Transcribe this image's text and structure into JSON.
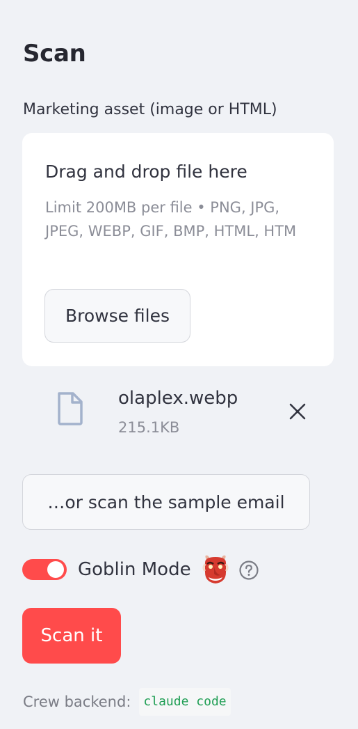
{
  "sidebar": {
    "title": "Scan",
    "uploader": {
      "label": "Marketing asset (image or HTML)",
      "dropzone_title": "Drag and drop file here",
      "limit_text": "Limit 200MB per file • PNG, JPG, JPEG, WEBP, GIF, BMP, HTML, HTM",
      "browse_label": "Browse files"
    },
    "uploaded_file": {
      "name": "olaplex.webp",
      "size": "215.1KB",
      "icon": "file-icon",
      "remove_icon": "close-icon"
    },
    "sample_button_label": "…or scan the sample email",
    "goblin_toggle": {
      "label": "Goblin Mode",
      "enabled": true,
      "emoji_icon": "goblin-mask-icon",
      "help_icon": "question-circle-icon"
    },
    "scan_button_label": "Scan it",
    "backend": {
      "label": "Crew backend:",
      "value": "claude code"
    }
  },
  "colors": {
    "background": "#f0f2f6",
    "accent": "#ff4b4b",
    "card": "#ffffff",
    "code_text": "#1f9e54",
    "muted_text": "#8b8d97"
  }
}
